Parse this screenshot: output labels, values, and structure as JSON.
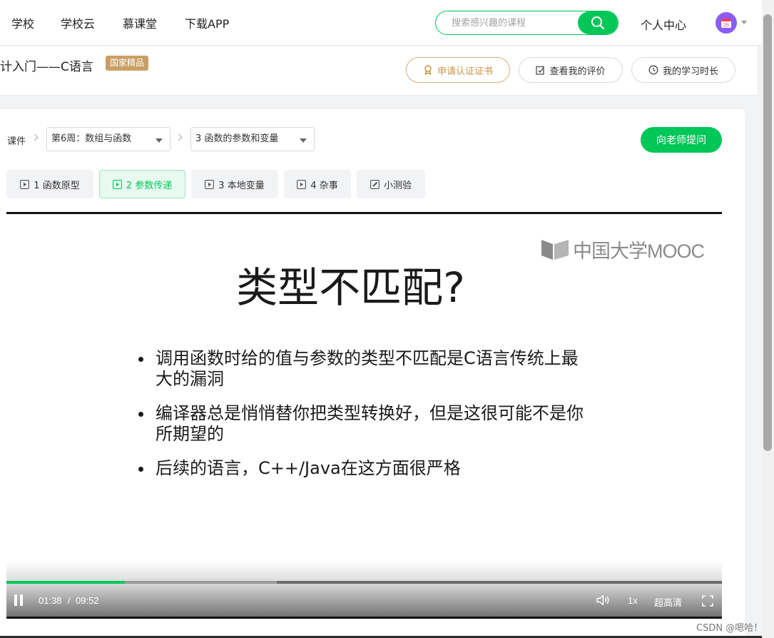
{
  "nav": {
    "links": [
      "学校",
      "学校云",
      "慕课堂",
      "下载APP"
    ],
    "search_placeholder": "搜索感兴趣的课程",
    "personal_center": "个人中心",
    "avatar_badge": "25"
  },
  "course": {
    "title": "计入门——C语言",
    "badge": "国家精品",
    "actions": {
      "certificate": "申请认证证书",
      "evaluation": "查看我的评价",
      "study_time": "我的学习时长"
    }
  },
  "breadcrumb": {
    "label": "课件",
    "week": "第6周：数组与函数",
    "chapter": "3 函数的参数和变量"
  },
  "ask_teacher": "向老师提问",
  "tabs": [
    {
      "label": "1 函数原型",
      "icon": "video-icon",
      "active": false
    },
    {
      "label": "2 参数传递",
      "icon": "video-icon",
      "active": true
    },
    {
      "label": "3 本地变量",
      "icon": "video-icon",
      "active": false
    },
    {
      "label": "4 杂事",
      "icon": "video-icon",
      "active": false
    },
    {
      "label": "小测验",
      "icon": "quiz-icon",
      "active": false
    }
  ],
  "slide": {
    "logo_text": "中国大学MOOC",
    "title": "类型不匹配?",
    "bullets": [
      "调用函数时给的值与参数的类型不匹配是C语言传统上最大的漏洞",
      "编译器总是悄悄替你把类型转换好，但是这很可能不是你所期望的",
      "后续的语言，C++/Java在这方面很严格"
    ]
  },
  "player": {
    "current_time": "01:38",
    "separator": "/",
    "duration": "09:52",
    "played_fraction": 0.166,
    "buffered_fraction": 0.378,
    "speed": "1x",
    "quality": "超高清"
  },
  "watermark": "CSDN @嗯哈！",
  "colors": {
    "accent": "#00c758",
    "badge": "#c9a063",
    "certificate": "#c9923d"
  }
}
